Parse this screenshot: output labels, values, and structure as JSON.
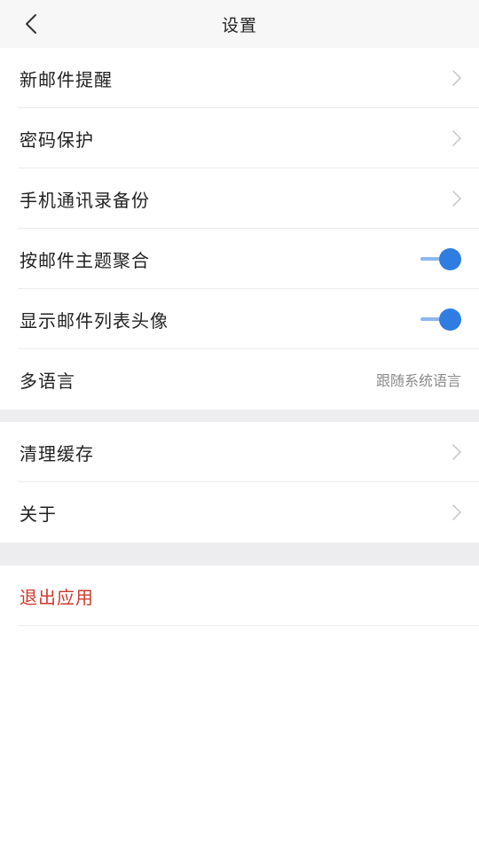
{
  "header": {
    "title": "设置",
    "back_icon": "chevron-left-icon"
  },
  "group1": {
    "items": [
      {
        "label": "新邮件提醒",
        "control": "chevron"
      },
      {
        "label": "密码保护",
        "control": "chevron"
      },
      {
        "label": "手机通讯录备份",
        "control": "chevron"
      },
      {
        "label": "按邮件主题聚合",
        "control": "toggle",
        "on": true
      },
      {
        "label": "显示邮件列表头像",
        "control": "toggle",
        "on": true
      },
      {
        "label": "多语言",
        "control": "value",
        "value": "跟随系统语言"
      }
    ]
  },
  "group2": {
    "items": [
      {
        "label": "清理缓存",
        "control": "chevron"
      },
      {
        "label": "关于",
        "control": "chevron"
      }
    ]
  },
  "exit": {
    "label": "退出应用"
  },
  "colors": {
    "accent": "#2f7de1",
    "danger": "#cf3a2e",
    "header_bg": "#f7f7f7",
    "section_gap": "#ededf0"
  }
}
